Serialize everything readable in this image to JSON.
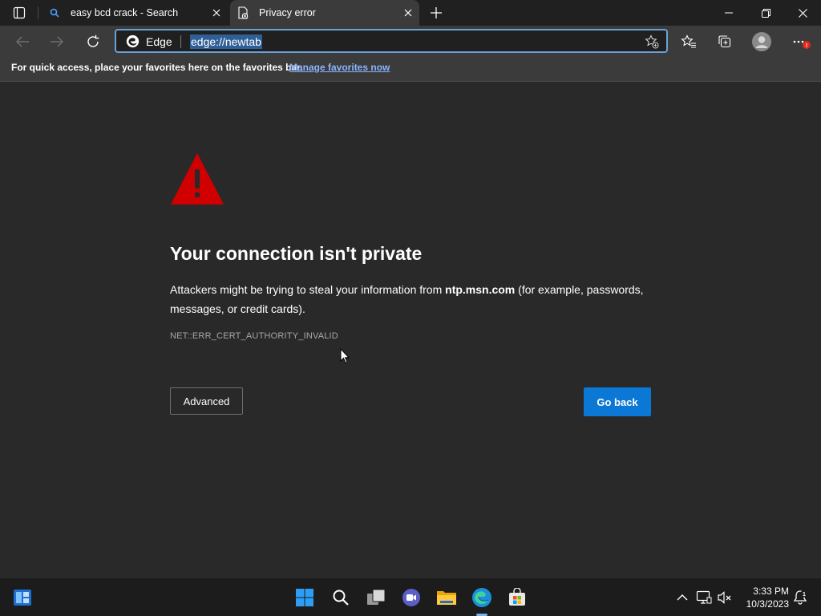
{
  "tabs": [
    {
      "title": "easy bcd crack - Search",
      "icon": "search-icon",
      "active": false
    },
    {
      "title": "Privacy error",
      "icon": "document-error-icon",
      "active": true
    }
  ],
  "toolbar": {
    "site_label": "Edge",
    "url": "edge://newtab"
  },
  "favorites_bar": {
    "message": "For quick access, place your favorites here on the favorites bar.",
    "link": "Manage favorites now"
  },
  "error_page": {
    "heading": "Your connection isn't private",
    "desc_before": "Attackers might be trying to steal your information from ",
    "desc_host": "ntp.msn.com",
    "desc_after": " (for example, passwords, messages, or credit cards).",
    "error_code": "NET::ERR_CERT_AUTHORITY_INVALID",
    "advanced_label": "Advanced",
    "go_back_label": "Go back"
  },
  "taskbar": {
    "time": "3:33 PM",
    "date": "10/3/2023",
    "notification_count": "1"
  },
  "colors": {
    "accent_blue": "#0a78d4",
    "warning_red": "#d00000",
    "link_blue": "#8ab4ff"
  }
}
